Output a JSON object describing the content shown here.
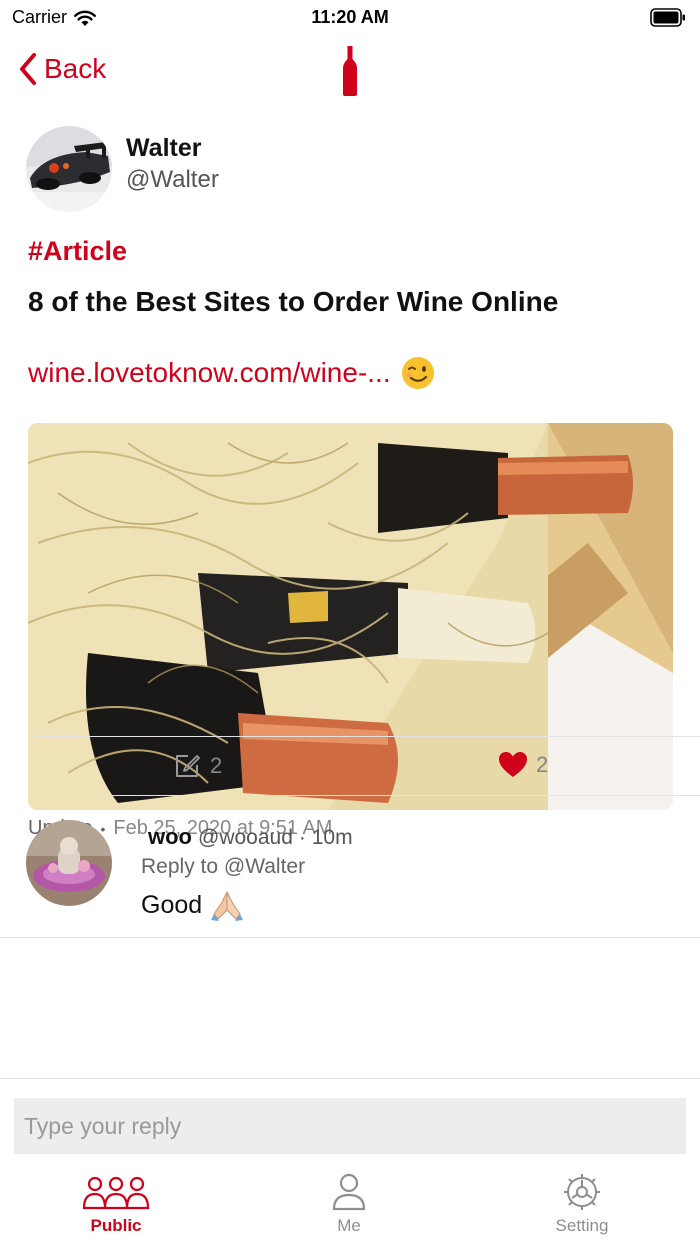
{
  "status_bar": {
    "carrier": "Carrier",
    "time": "11:20 AM"
  },
  "nav": {
    "back_label": "Back",
    "accent_color": "#d0021b"
  },
  "post": {
    "author_name": "Walter",
    "author_handle": "@Walter",
    "tag": "#Article",
    "title": "8 of the Best Sites to Order Wine Online",
    "link_text": "wine.lovetoknow.com/wine-...",
    "meta_label": "Update",
    "meta_time": "Feb 25, 2020 at 9:51 AM",
    "comment_count": "2",
    "like_count": "2"
  },
  "reply": {
    "name": "woo",
    "handle": "@wooaud",
    "age": "· 10m",
    "reply_to": "Reply to @Walter",
    "body": "Good"
  },
  "composer": {
    "placeholder": "Type your reply"
  },
  "tabs": [
    {
      "label": "Public",
      "icon": "people-icon",
      "active": true
    },
    {
      "label": "Me",
      "icon": "person-icon",
      "active": false
    },
    {
      "label": "Setting",
      "icon": "gear-icon",
      "active": false
    }
  ]
}
